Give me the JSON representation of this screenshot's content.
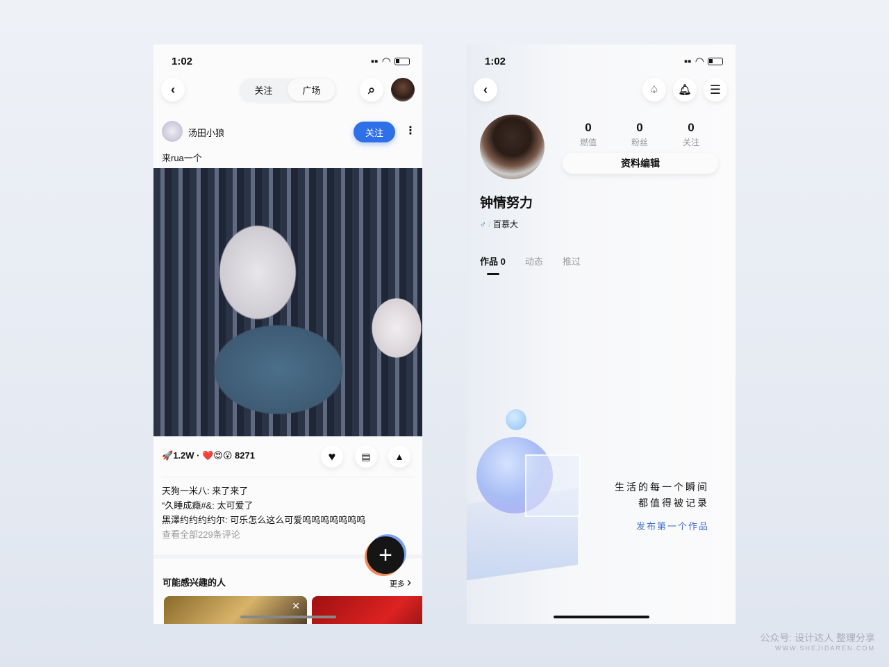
{
  "feed": {
    "status": {
      "time": "1:02"
    },
    "tabs": [
      {
        "label": "关注",
        "active": false
      },
      {
        "label": "广场",
        "active": true
      }
    ],
    "post": {
      "username": "汤田小狼",
      "follow_label": "关注",
      "caption": "来rua一个",
      "views": "1.2W",
      "reactions": "8271"
    },
    "comments": [
      {
        "user": "天狗一米八",
        "text": "来了来了"
      },
      {
        "user": "“久睡成瘾#&",
        "text": "太可爱了"
      },
      {
        "user": "黑澤约约约约尔",
        "text": "可乐怎么这么可爱呜呜呜呜呜呜呜"
      }
    ],
    "view_all": "查看全部229条评论",
    "suggest_title": "可能感兴趣的人",
    "suggest_more": "更多"
  },
  "profile": {
    "status": {
      "time": "1:02"
    },
    "stats": [
      {
        "value": "0",
        "label": "燃值"
      },
      {
        "value": "0",
        "label": "粉丝"
      },
      {
        "value": "0",
        "label": "关注"
      }
    ],
    "edit_label": "资料编辑",
    "name": "钟情努力",
    "gender": "♂",
    "school": "百慕大",
    "tabs": [
      {
        "label": "作品 0"
      },
      {
        "label": "动态"
      },
      {
        "label": "推过"
      }
    ],
    "empty_line1": "生活的每一个瞬间",
    "empty_line2": "都值得被记录",
    "publish_label": "发布第一个作品"
  },
  "watermark": {
    "line1": "公众号: 设计达人 整理分享",
    "line2": "WWW.SHEJIDAREN.COM"
  },
  "colors": {
    "accent": "#2f6fe8",
    "link": "#3d6fd0"
  }
}
